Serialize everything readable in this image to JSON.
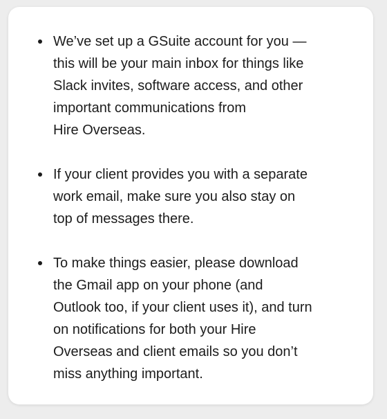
{
  "bullets": [
    {
      "text_lines": [
        "We’ve set up a GSuite account for you —",
        "this will be your main inbox for things like",
        "Slack invites, software access, and other",
        "important communications from",
        "Hire Overseas."
      ]
    },
    {
      "text_lines": [
        "If your client provides you with a separate",
        "work email, make sure you also stay on",
        "top of messages there."
      ]
    },
    {
      "text_lines": [
        "To make things easier, please download",
        "the Gmail app on your phone (and",
        "Outlook too, if your client uses it), and turn",
        "on notifications for both your Hire",
        "Overseas and client emails so you don’t",
        "miss anything important."
      ]
    }
  ]
}
